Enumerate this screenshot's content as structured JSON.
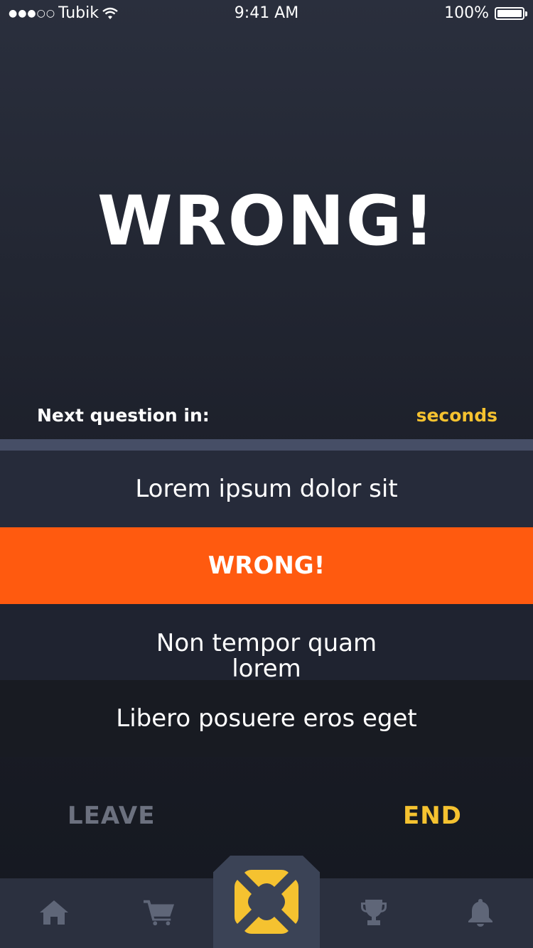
{
  "status_bar": {
    "carrier": "Tubik",
    "time": "9:41 AM",
    "battery": "100%"
  },
  "result": {
    "title": "WRONG!"
  },
  "timer": {
    "label": "Next question in:",
    "unit": "seconds"
  },
  "options": [
    {
      "label": "Lorem ipsum dolor sit",
      "state": "default"
    },
    {
      "label": "WRONG!",
      "state": "wrong"
    },
    {
      "label": "Non tempor quam lorem",
      "state": "default"
    },
    {
      "label": "Libero posuere eros eget",
      "state": "default"
    }
  ],
  "actions": {
    "leave": "LEAVE",
    "end": "END"
  },
  "tab_bar": {
    "tabs": [
      {
        "icon": "home-icon"
      },
      {
        "icon": "cart-icon"
      },
      {
        "icon": "quiz-logo-icon",
        "active": true
      },
      {
        "icon": "trophy-icon"
      },
      {
        "icon": "bell-icon"
      }
    ]
  },
  "colors": {
    "accent_yellow": "#f5c230",
    "wrong_orange": "#ff5a0f",
    "tab_icon": "#5f6678"
  }
}
